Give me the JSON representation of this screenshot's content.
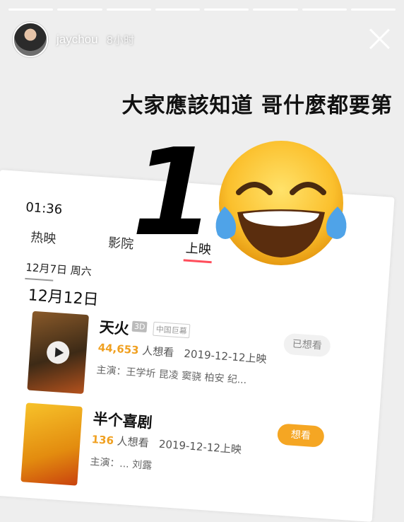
{
  "story": {
    "username": "jaychou",
    "time": "8小时",
    "caption": "大家應該知道 哥什麼都要第",
    "big_number": "1",
    "segments": 8
  },
  "screenshot": {
    "clock": "01:36",
    "tabs": [
      {
        "label": "热映"
      },
      {
        "label": "影院"
      },
      {
        "label": "上映"
      }
    ],
    "date_small": "12月7日 周六",
    "date_large": "12月12日",
    "movies": [
      {
        "title": "天火",
        "tag_3d": "3D",
        "tag_format": "中国巨幕",
        "want_count": "44,653",
        "want_label": "人想看",
        "release": "2019-12-12上映",
        "cast": "主演：王学圻 昆凌 窦骁 柏安 纪...",
        "action": "已想看"
      },
      {
        "title": "半个喜剧",
        "want_count": "136",
        "want_label": "人想看",
        "release": "2019-12-12上映",
        "cast": "主演：... 刘露",
        "action": "想看"
      }
    ]
  },
  "colors": {
    "accent_orange": "#f5a623",
    "tab_underline": "#ff4d5b"
  }
}
